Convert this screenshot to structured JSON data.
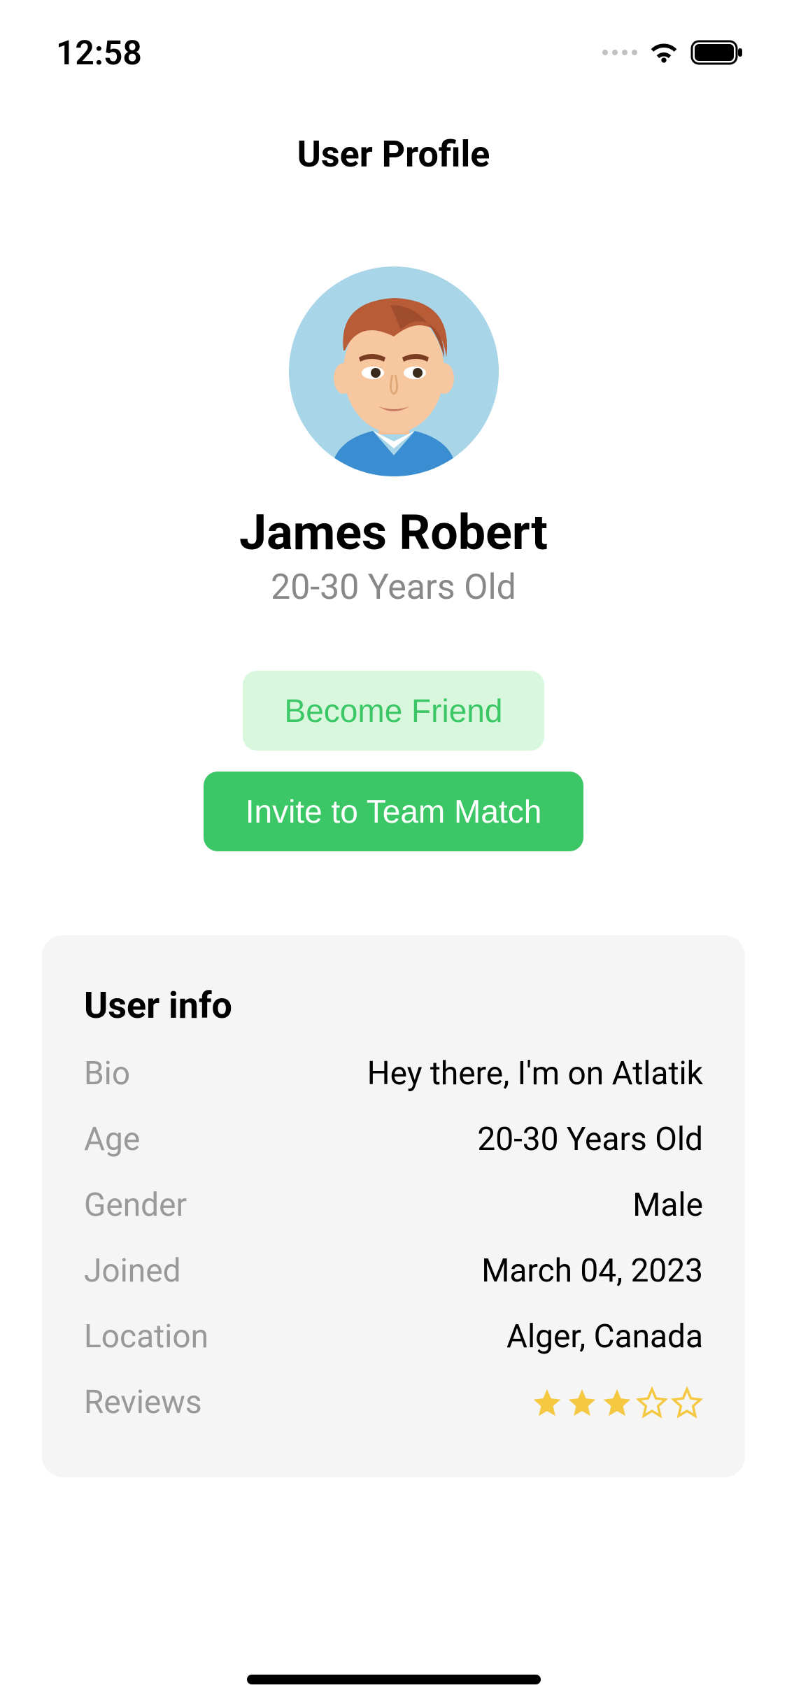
{
  "statusBar": {
    "time": "12:58"
  },
  "header": {
    "title": "User Profile"
  },
  "profile": {
    "name": "James Robert",
    "ageRange": "20-30 Years Old"
  },
  "buttons": {
    "becomeFriend": "Become Friend",
    "inviteTeamMatch": "Invite to Team Match"
  },
  "userInfo": {
    "title": "User info",
    "labels": {
      "bio": "Bio",
      "age": "Age",
      "gender": "Gender",
      "joined": "Joined",
      "location": "Location",
      "reviews": "Reviews"
    },
    "values": {
      "bio": "Hey there, I'm on Atlatik",
      "age": "20-30 Years Old",
      "gender": "Male",
      "joined": "March 04, 2023",
      "location": "Alger, Canada"
    },
    "rating": {
      "filled": 3,
      "total": 5
    }
  },
  "colors": {
    "accentGreen": "#3bc766",
    "lightGreen": "#d9f7dc",
    "starGold": "#f5c842",
    "grayLabel": "#999",
    "cardBg": "#f5f5f5"
  }
}
